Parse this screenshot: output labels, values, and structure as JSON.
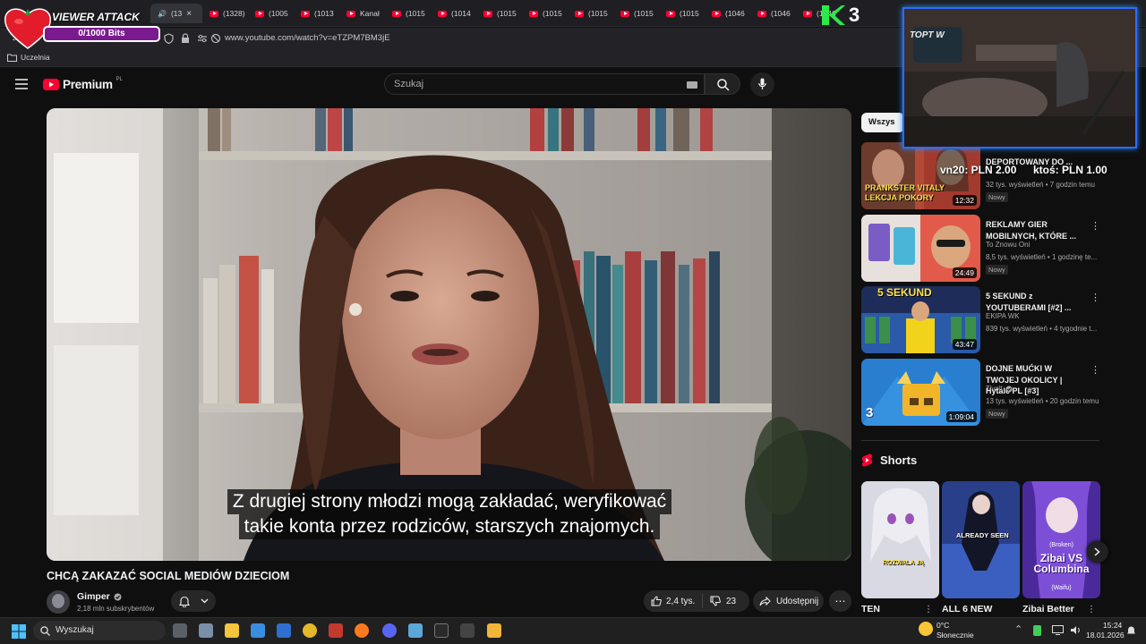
{
  "overlay": {
    "viewer_attack_title": "VIEWER ATTACK",
    "bits_progress": "0/1000 Bits",
    "donation_1": "vn20: PLN 2.00",
    "donation_2": "ktoś: PLN 1.00",
    "k3_label": "3"
  },
  "browser": {
    "tabs": [
      {
        "label": "(13"
      },
      {
        "label": "(1328)"
      },
      {
        "label": "(1005"
      },
      {
        "label": "(1013"
      },
      {
        "label": "Kanał"
      },
      {
        "label": "(1015"
      },
      {
        "label": "(1014"
      },
      {
        "label": "(1015"
      },
      {
        "label": "(1015"
      },
      {
        "label": "(1015"
      },
      {
        "label": "(1015"
      },
      {
        "label": "(1015"
      },
      {
        "label": "(1046"
      },
      {
        "label": "(1046"
      },
      {
        "label": "(1046"
      }
    ],
    "url": "www.youtube.com/watch?v=eTZPM7BM3jE",
    "bookmark": "Uczelnia"
  },
  "youtube": {
    "logo_text": "Premium",
    "logo_region": "PL",
    "search_placeholder": "Szukaj",
    "filter_chip": "Wszys"
  },
  "video": {
    "subtitle_line1": "Z drugiej strony młodzi mogą zakładać, weryfikować",
    "subtitle_line2": "takie konta przez rodziców, starszych znajomych.",
    "title": "CHCĄ ZAKAZAĆ SOCIAL MEDIÓW DZIECIOM",
    "channel": "Gimper",
    "subscribers": "2,18 mln subskrybentów",
    "likes": "2,4 tys.",
    "dislikes": "23",
    "share_label": "Udostępnij"
  },
  "recommendations": [
    {
      "title": "DEPORTOWANY DO ...",
      "thumb_text": "PRANKSTER VITALY LEKCJA POKORY",
      "channel": "",
      "meta": "32 tys. wyświetleń • 7 godzin temu",
      "badge": "Nowy",
      "duration": "12:32"
    },
    {
      "title": "REKLAMY GIER MOBILNYCH, KTÓRE ...",
      "thumb_text": "",
      "channel": "To Znowu Oni",
      "meta": "8,5 tys. wyświetleń • 1 godzinę te...",
      "badge": "Nowy",
      "duration": "24:49"
    },
    {
      "title": "5 SEKUND z YOUTUBERAMI [#2] ...",
      "thumb_text": "5 SEKUND",
      "channel": "EKIPA WK",
      "meta": "839 tys. wyświetleń • 4 tygodnie t...",
      "badge": "",
      "duration": "43:47"
    },
    {
      "title": "DOJNE MUĆKI W TWOJEJ OKOLICY | Hytale PL [#3]",
      "thumb_text": "3",
      "channel": "Tivolt",
      "meta": "13 tys. wyświetleń • 20 godzin temu",
      "badge": "Nowy",
      "duration": "1:09:04"
    }
  ],
  "shorts": {
    "heading": "Shorts",
    "items": [
      {
        "title": "TEN",
        "thumb_text": "ROZWALA JĄ"
      },
      {
        "title": "ALL 6 NEW",
        "thumb_text": "ALREADY SEEN"
      },
      {
        "title": "Zibai Better",
        "thumb_text": "Zibai VS Columbina",
        "thumb_sub1": "(Broken)",
        "thumb_sub2": "(Waifu)"
      }
    ]
  },
  "taskbar": {
    "search_label": "Wyszukaj",
    "weather_temp": "0°C",
    "weather_desc": "Słonecznie",
    "time": "15:24",
    "date": "18.01.2026"
  },
  "colors": {
    "yt_red": "#ff0033",
    "bits_bar": "#7a1a8f",
    "cam_border": "#2e6bff",
    "k3_green": "#2ee84a"
  }
}
